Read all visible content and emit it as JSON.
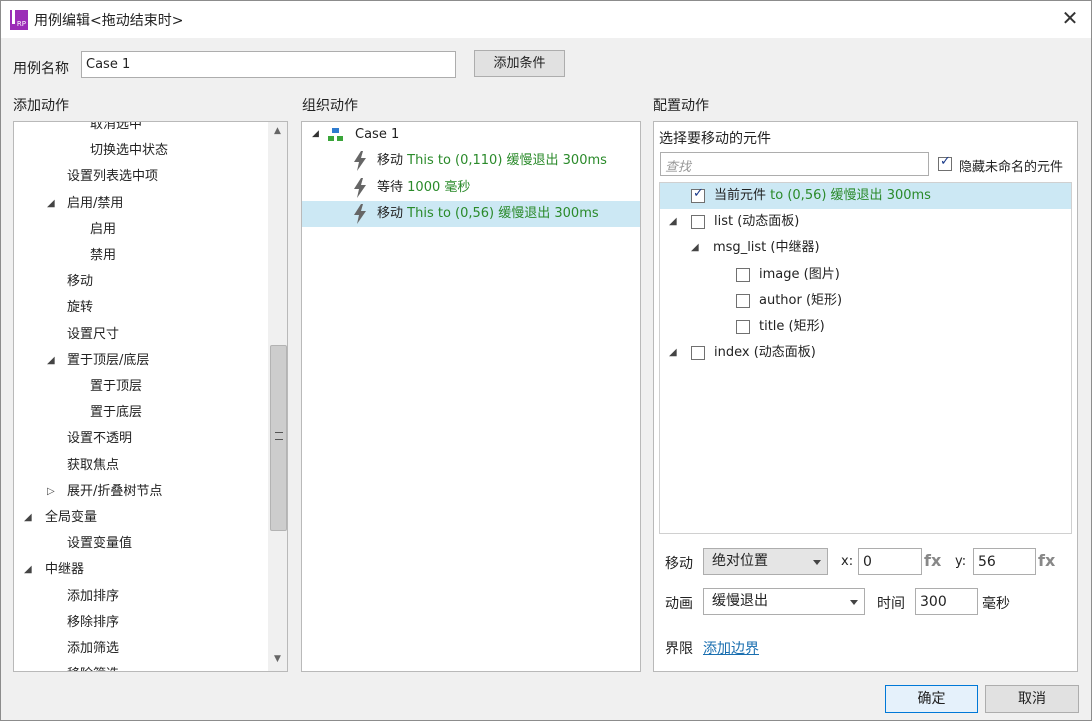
{
  "window": {
    "title": "用例编辑<拖动结束时>",
    "app_icon_text": "RP"
  },
  "case_name": {
    "label": "用例名称",
    "value": "Case 1",
    "add_condition": "添加条件"
  },
  "add_actions": {
    "heading": "添加动作",
    "items": [
      {
        "label": "取消选中",
        "indent": 3
      },
      {
        "label": "切换选中状态",
        "indent": 3
      },
      {
        "label": "设置列表选中项",
        "indent": 2
      },
      {
        "label": "启用/禁用",
        "indent": 1,
        "expand": "open"
      },
      {
        "label": "启用",
        "indent": 3
      },
      {
        "label": "禁用",
        "indent": 3
      },
      {
        "label": "移动",
        "indent": 2
      },
      {
        "label": "旋转",
        "indent": 2
      },
      {
        "label": "设置尺寸",
        "indent": 2
      },
      {
        "label": "置于顶层/底层",
        "indent": 1,
        "expand": "open"
      },
      {
        "label": "置于顶层",
        "indent": 3
      },
      {
        "label": "置于底层",
        "indent": 3
      },
      {
        "label": "设置不透明",
        "indent": 2
      },
      {
        "label": "获取焦点",
        "indent": 2
      },
      {
        "label": "展开/折叠树节点",
        "indent": 1,
        "expand": "closed"
      },
      {
        "label": "全局变量",
        "indent": 0,
        "expand": "open"
      },
      {
        "label": "设置变量值",
        "indent": 2
      },
      {
        "label": "中继器",
        "indent": 0,
        "expand": "open"
      },
      {
        "label": "添加排序",
        "indent": 2
      },
      {
        "label": "移除排序",
        "indent": 2
      },
      {
        "label": "添加筛选",
        "indent": 2
      },
      {
        "label": "移除筛选",
        "indent": 2
      }
    ]
  },
  "organize_actions": {
    "heading": "组织动作",
    "case_label": "Case 1",
    "actions": [
      {
        "verb": "移动",
        "detail": "This to (0,110) 缓慢退出 300ms",
        "selected": false
      },
      {
        "verb": "等待",
        "detail": "1000 毫秒",
        "selected": false
      },
      {
        "verb": "移动",
        "detail": "This to (0,56) 缓慢退出 300ms",
        "selected": true
      }
    ]
  },
  "configure": {
    "heading": "配置动作",
    "subheading": "选择要移动的元件",
    "search_placeholder": "查找",
    "hide_unnamed": {
      "label": "隐藏未命名的元件",
      "checked": true
    },
    "tree": [
      {
        "name": "当前元件",
        "detail": "to (0,56) 缓慢退出 300ms",
        "checked": true,
        "selected": true
      },
      {
        "name": "list (动态面板)",
        "checked": false
      },
      {
        "name": "msg_list (中继器)"
      },
      {
        "name": "image (图片)",
        "checked": false
      },
      {
        "name": "author (矩形)",
        "checked": false
      },
      {
        "name": "title (矩形)",
        "checked": false
      },
      {
        "name": "index (动态面板)",
        "checked": false
      }
    ],
    "move": {
      "label": "移动",
      "mode": "绝对位置",
      "x_label": "x:",
      "x": "0",
      "y_label": "y:",
      "y": "56",
      "fx": "fx"
    },
    "animate": {
      "label": "动画",
      "mode": "缓慢退出",
      "time_label": "时间",
      "time": "300",
      "unit": "毫秒"
    },
    "bounds": {
      "label": "界限",
      "link": "添加边界"
    }
  },
  "footer": {
    "ok": "确定",
    "cancel": "取消"
  },
  "colors": {
    "selection": "#cce8f4",
    "action_detail": "#2a8a2a",
    "link": "#1a6fb0",
    "accent": "#0078d7"
  }
}
